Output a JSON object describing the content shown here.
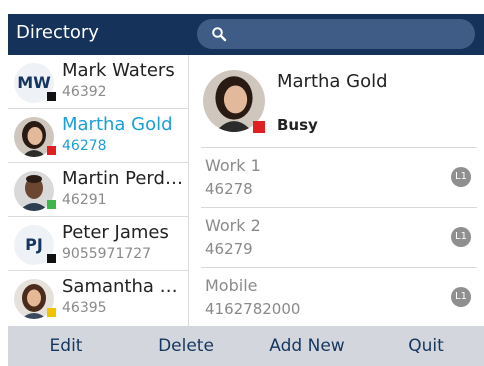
{
  "header": {
    "title": "Directory"
  },
  "search": {
    "icon": "search-icon"
  },
  "contacts": [
    {
      "name": "Mark Waters",
      "number": "46392",
      "initials": "MW",
      "status_color": "#111111",
      "avatar": "initials"
    },
    {
      "name": "Martha Gold",
      "number": "46278",
      "status_color": "#e02020",
      "avatar": "photo",
      "selected": true
    },
    {
      "name": "Martin Perdue",
      "number": "46291",
      "status_color": "#3db74a",
      "avatar": "photo"
    },
    {
      "name": "Peter James",
      "number": "9055971727",
      "initials": "PJ",
      "status_color": "#111111",
      "avatar": "initials"
    },
    {
      "name": "Samantha Lee",
      "number": "46395",
      "status_color": "#f2c200",
      "avatar": "photo"
    }
  ],
  "details": {
    "name": "Martha Gold",
    "status": "Busy",
    "status_color": "#e02020",
    "fields": [
      {
        "label": "Work 1",
        "value": "46278",
        "line": "L1"
      },
      {
        "label": "Work 2",
        "value": "46279",
        "line": "L1"
      },
      {
        "label": "Mobile",
        "value": "4162782000",
        "line": "L1"
      }
    ]
  },
  "softkeys": {
    "edit": "Edit",
    "delete": "Delete",
    "add_new": "Add New",
    "quit": "Quit"
  },
  "colors": {
    "header_bg": "#14325a",
    "search_bg": "#3f5c87",
    "selected_text": "#1a9fd9",
    "softkey_bg": "#d3d7dd",
    "softkey_text": "#15365f"
  }
}
